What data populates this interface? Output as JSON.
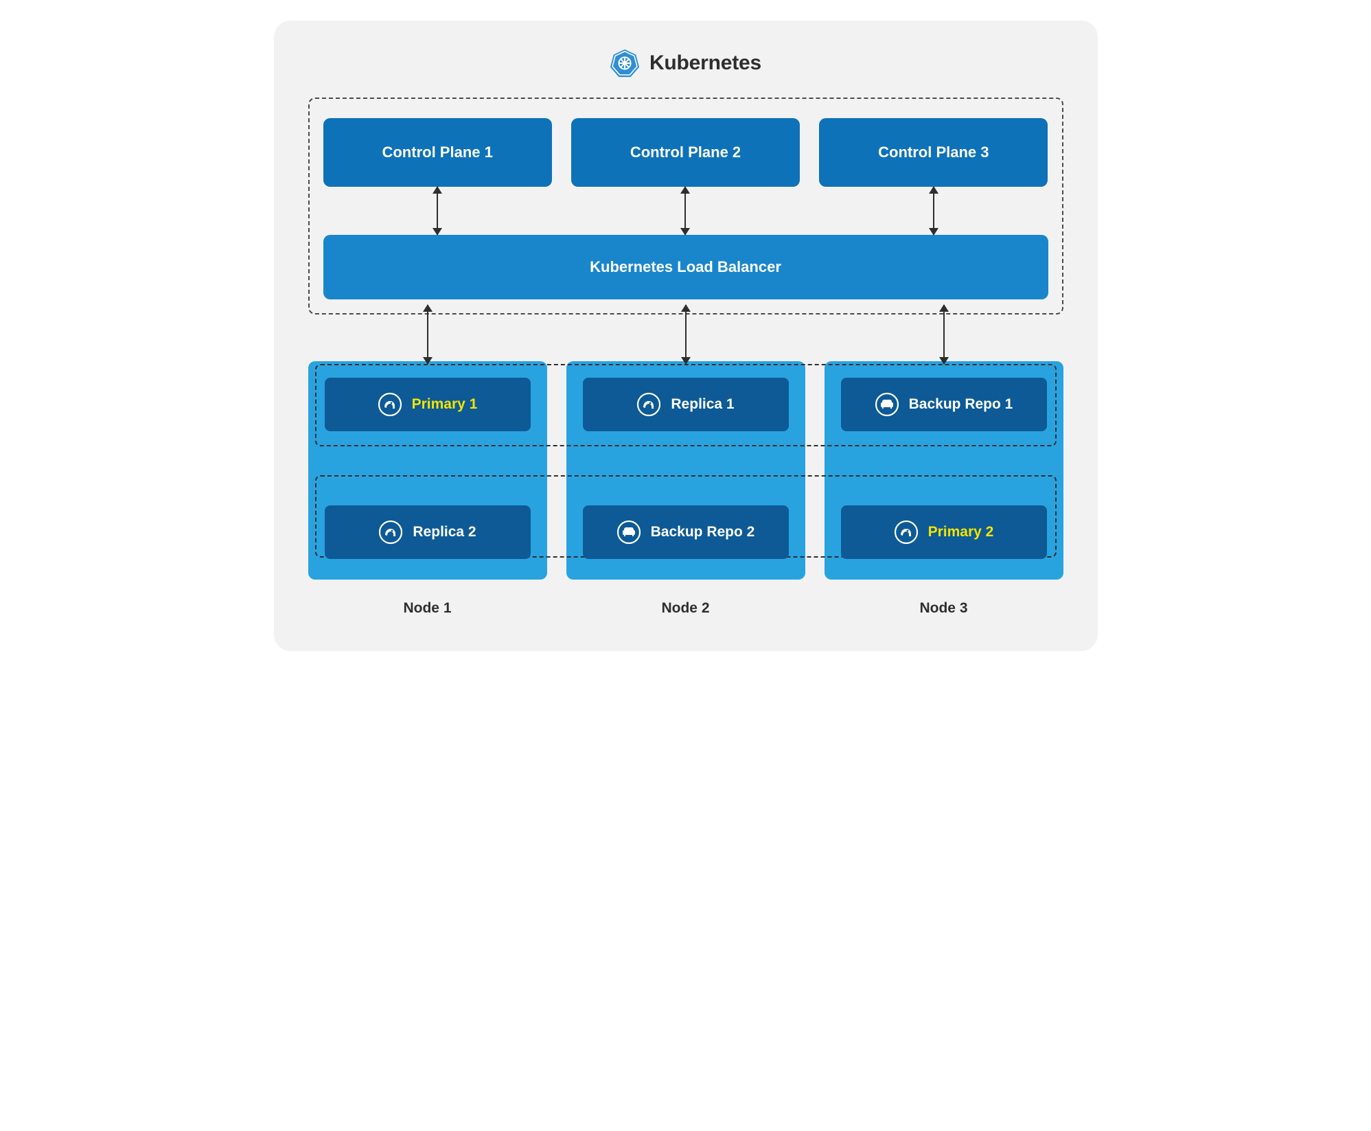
{
  "header": {
    "title": "Kubernetes",
    "logo_name": "kubernetes-icon"
  },
  "control_planes": [
    {
      "label": "Control Plane 1"
    },
    {
      "label": "Control Plane 2"
    },
    {
      "label": "Control Plane 3"
    }
  ],
  "load_balancer": {
    "label": "Kubernetes Load Balancer"
  },
  "nodes": [
    {
      "name": "Node 1",
      "pods": [
        {
          "label": "Primary 1",
          "icon": "elephant-icon",
          "primary": true
        },
        {
          "label": "Replica 2",
          "icon": "elephant-icon",
          "primary": false
        }
      ]
    },
    {
      "name": "Node 2",
      "pods": [
        {
          "label": "Replica 1",
          "icon": "elephant-icon",
          "primary": false
        },
        {
          "label": "Backup Repo 2",
          "icon": "sofa-icon",
          "primary": false
        }
      ]
    },
    {
      "name": "Node 3",
      "pods": [
        {
          "label": "Backup Repo 1",
          "icon": "sofa-icon",
          "primary": false
        },
        {
          "label": "Primary 2",
          "icon": "elephant-icon",
          "primary": true
        }
      ]
    }
  ],
  "colors": {
    "background": "#f2f2f2",
    "control_plane": "#0d72b8",
    "load_balancer": "#1986cc",
    "node": "#29a3e0",
    "pod": "#0d5a96",
    "primary_text": "#f5e400",
    "text_dark": "#2e2e2e"
  }
}
